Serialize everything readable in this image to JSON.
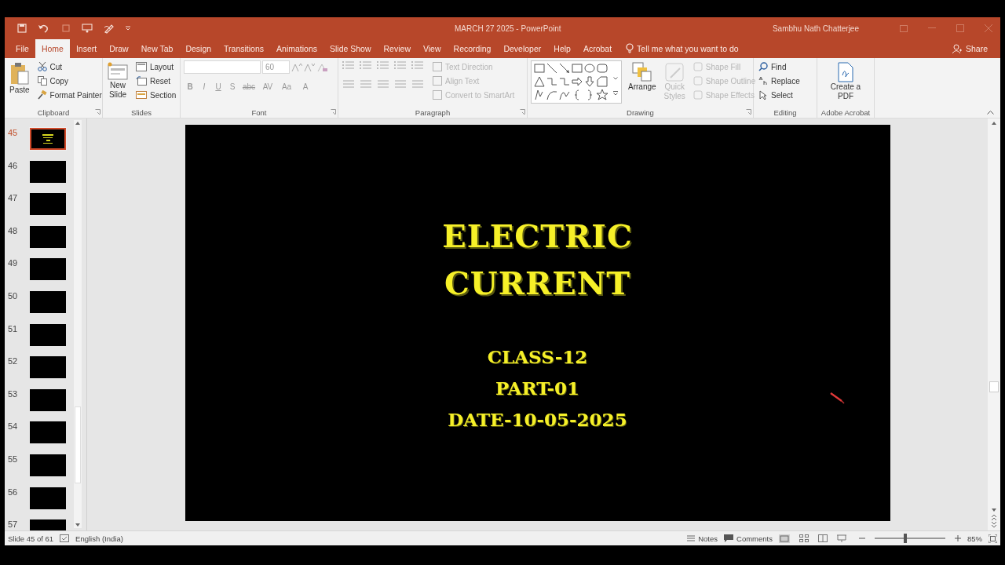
{
  "title_bar": {
    "title": "MARCH 27 2025  -  PowerPoint",
    "user": "Sambhu Nath Chatterjee"
  },
  "tabs": [
    {
      "label": "File",
      "selected": false
    },
    {
      "label": "Home",
      "selected": true
    },
    {
      "label": "Insert",
      "selected": false
    },
    {
      "label": "Draw",
      "selected": false
    },
    {
      "label": "New Tab",
      "selected": false
    },
    {
      "label": "Design",
      "selected": false
    },
    {
      "label": "Transitions",
      "selected": false
    },
    {
      "label": "Animations",
      "selected": false
    },
    {
      "label": "Slide Show",
      "selected": false
    },
    {
      "label": "Review",
      "selected": false
    },
    {
      "label": "View",
      "selected": false
    },
    {
      "label": "Recording",
      "selected": false
    },
    {
      "label": "Developer",
      "selected": false
    },
    {
      "label": "Help",
      "selected": false
    },
    {
      "label": "Acrobat",
      "selected": false
    }
  ],
  "tell_me": {
    "placeholder": "Tell me what you want to do"
  },
  "share": "Share",
  "ribbon": [
    {
      "kind": "clipboard",
      "label": "Clipboard",
      "paste": "Paste",
      "items": [
        "Cut",
        "Copy",
        "Format Painter"
      ]
    },
    {
      "kind": "slides",
      "label": "Slides",
      "new_slide": "New Slide",
      "items": [
        "Layout",
        "Reset",
        "Section"
      ]
    },
    {
      "kind": "font",
      "label": "Font",
      "font_size": "60",
      "format_buttons": [
        "B",
        "I",
        "U",
        "S",
        "abc",
        "AV",
        "Aa",
        "A"
      ]
    },
    {
      "kind": "paragraph",
      "label": "Paragraph",
      "items": [
        {
          "label": "Text Direction",
          "disabled": true
        },
        {
          "label": "Align Text",
          "disabled": true
        },
        {
          "label": "Convert to SmartArt",
          "disabled": true
        }
      ]
    },
    {
      "kind": "drawing",
      "label": "Drawing",
      "arrange": "Arrange",
      "quick_styles": {
        "label": "Quick Styles",
        "disabled": true
      },
      "items": [
        {
          "label": "Shape Fill",
          "disabled": true
        },
        {
          "label": "Shape Outline",
          "disabled": true
        },
        {
          "label": "Shape Effects",
          "disabled": true
        }
      ]
    },
    {
      "kind": "editing",
      "label": "Editing",
      "items": [
        "Find",
        "Replace",
        "Select"
      ]
    },
    {
      "kind": "acrobat",
      "label": "Adobe Acrobat",
      "create": "Create a PDF"
    }
  ],
  "thumbnails": [
    {
      "number": "45",
      "selected": true
    },
    {
      "number": "46",
      "selected": false
    },
    {
      "number": "47",
      "selected": false
    },
    {
      "number": "48",
      "selected": false
    },
    {
      "number": "49",
      "selected": false
    },
    {
      "number": "50",
      "selected": false
    },
    {
      "number": "51",
      "selected": false
    },
    {
      "number": "52",
      "selected": false
    },
    {
      "number": "53",
      "selected": false
    },
    {
      "number": "54",
      "selected": false
    },
    {
      "number": "55",
      "selected": false
    },
    {
      "number": "56",
      "selected": false
    },
    {
      "number": "57",
      "selected": false
    }
  ],
  "slide": {
    "title": "ELECTRIC CURRENT",
    "lines": [
      "CLASS-12",
      "PART-01",
      "DATE-10-05-2025"
    ]
  },
  "status_bar": {
    "slide_info": "Slide 45 of 61",
    "language": "English (India)",
    "notes": "Notes",
    "comments": "Comments",
    "zoom": {
      "level": 0.43
    },
    "zoom_reading": "85%"
  }
}
